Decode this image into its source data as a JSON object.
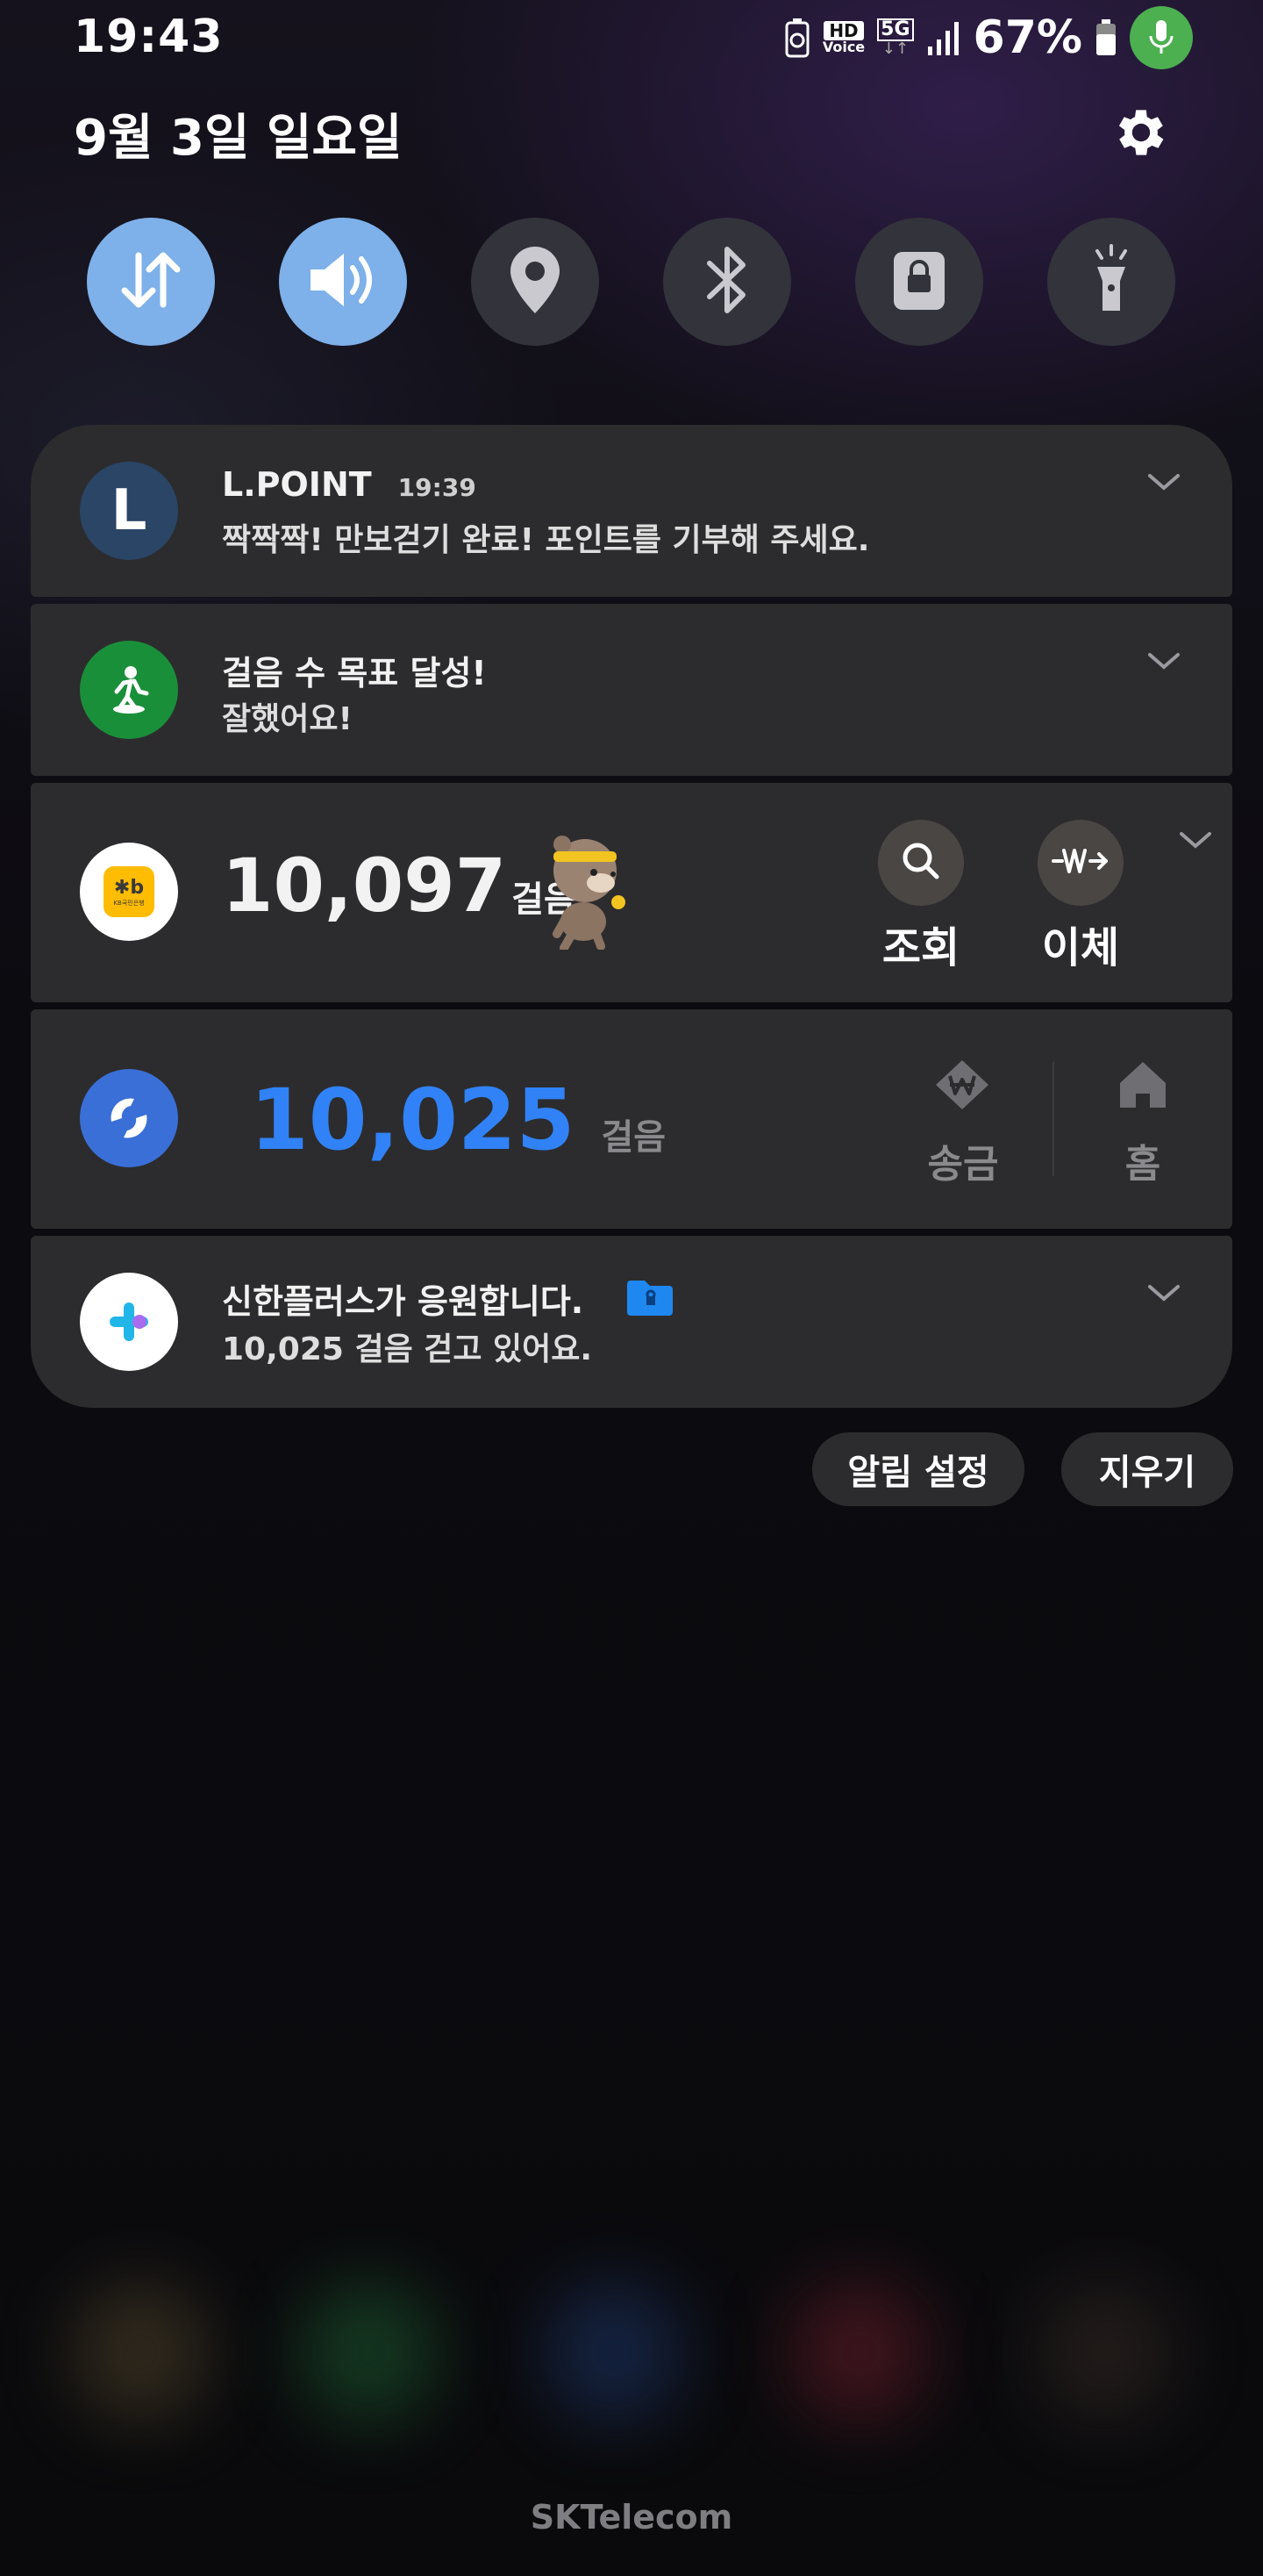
{
  "status_bar": {
    "time": "19:43",
    "battery_percent": "67%",
    "icons": [
      "battery-saver-icon",
      "hd-voice-icon",
      "5g-icon",
      "signal-icon",
      "battery-icon",
      "mic-icon"
    ],
    "hd_label": "HD",
    "voice_label": "Voice",
    "network_label": "5G"
  },
  "header": {
    "date": "9월 3일 일요일"
  },
  "quick_toggles": [
    {
      "name": "mobile-data",
      "icon": "data-arrows-icon",
      "state": "on"
    },
    {
      "name": "sound",
      "icon": "speaker-icon",
      "state": "on"
    },
    {
      "name": "location",
      "icon": "location-pin-icon",
      "state": "off"
    },
    {
      "name": "bluetooth",
      "icon": "bluetooth-icon",
      "state": "off"
    },
    {
      "name": "secure-folder",
      "icon": "lock-icon",
      "state": "off"
    },
    {
      "name": "flashlight",
      "icon": "flashlight-icon",
      "state": "off"
    }
  ],
  "notifications": {
    "lpoint": {
      "app": "L.POINT",
      "time": "19:39",
      "message": "짝짝짝! 만보걷기 완료! 포인트를 기부해 주세요.",
      "icon_letter": "L"
    },
    "steps_goal": {
      "title": "걸음 수 목표 달성!",
      "message": "잘했어요!"
    },
    "kb": {
      "steps": "10,097",
      "unit": "걸음",
      "icon_text": "KB국민은행",
      "btn_search": "조회",
      "btn_transfer": "이체"
    },
    "toss": {
      "steps": "10,025",
      "unit": "걸음",
      "btn_send": "송금",
      "btn_home": "홈"
    },
    "shinhan": {
      "title": "신한플러스가 응원합니다.",
      "message": "10,025 걸음 걷고 있어요."
    }
  },
  "actions": {
    "settings_label": "알림 설정",
    "clear_label": "지우기"
  },
  "footer": {
    "carrier": "SKTelecom"
  },
  "colors": {
    "toggle_on": "#7eb0ea",
    "toggle_off": "#33333b",
    "card_bg": "#2c2c2e",
    "toss_blue": "#3182f6",
    "steps_green": "#1a8f3a"
  }
}
